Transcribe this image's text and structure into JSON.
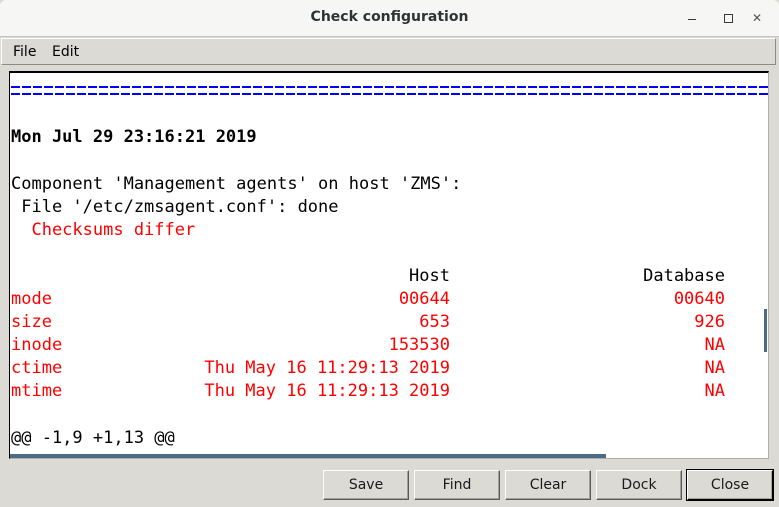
{
  "window": {
    "title": "Check configuration",
    "controls": {
      "minimize": "minimize-icon",
      "maximize": "maximize-icon",
      "close": "close-icon"
    }
  },
  "menubar": {
    "items": [
      {
        "label": "File"
      },
      {
        "label": "Edit"
      }
    ]
  },
  "output": {
    "separator_char": "=",
    "timestamp": "Mon Jul 29 23:16:21 2019",
    "component_line": "Component 'Management agents' on host 'ZMS':",
    "file_line": " File '/etc/zmsagent.conf': done",
    "status_line": "  Checksums differ",
    "table": {
      "headers": {
        "host": "Host",
        "database": "Database"
      },
      "rows": [
        {
          "attr": "mode",
          "host": "00644",
          "database": "00640"
        },
        {
          "attr": "size",
          "host": "653",
          "database": "926"
        },
        {
          "attr": "inode",
          "host": "153530",
          "database": "NA"
        },
        {
          "attr": "ctime",
          "host": "Thu May 16 11:29:13 2019",
          "database": "NA"
        },
        {
          "attr": "mtime",
          "host": "Thu May 16 11:29:13 2019",
          "database": "NA"
        }
      ]
    },
    "diff_header": "@@ -1,9 +1,13 @@"
  },
  "colors": {
    "error_text": "#ff0000",
    "separator": "#0000ff",
    "scrollbar": "#4b6a88"
  },
  "buttons": {
    "save": "Save",
    "find": "Find",
    "clear": "Clear",
    "dock": "Dock",
    "close": "Close"
  }
}
